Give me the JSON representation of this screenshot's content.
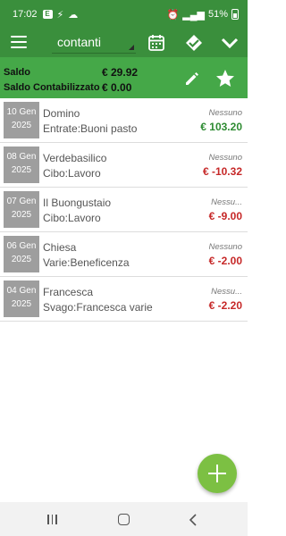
{
  "statusbar": {
    "time": "17:02",
    "battery": "51%"
  },
  "toolbar": {
    "account": "contanti"
  },
  "summary": {
    "saldo_label": "Saldo",
    "saldo_value": "€ 29.92",
    "contab_label": "Saldo Contabilizzato",
    "contab_value": "€ 0.00"
  },
  "transactions": [
    {
      "day": "10 Gen",
      "year": "2025",
      "description": "Domino",
      "category": "Entrate:Buoni pasto",
      "status": "Nessuno",
      "amount": "€ 103.20",
      "sign": "pos"
    },
    {
      "day": "08 Gen",
      "year": "2025",
      "description": "Verdebasilico",
      "category": "Cibo:Lavoro",
      "status": "Nessuno",
      "amount": "€ -10.32",
      "sign": "neg"
    },
    {
      "day": "07 Gen",
      "year": "2025",
      "description": "Il Buongustaio",
      "category": "Cibo:Lavoro",
      "status": "Nessu...",
      "amount": "€ -9.00",
      "sign": "neg"
    },
    {
      "day": "06 Gen",
      "year": "2025",
      "description": "Chiesa",
      "category": "Varie:Beneficenza",
      "status": "Nessuno",
      "amount": "€ -2.00",
      "sign": "neg"
    },
    {
      "day": "04 Gen",
      "year": "2025",
      "description": "Francesca",
      "category": "Svago:Francesca varie",
      "status": "Nessu...",
      "amount": "€ -2.20",
      "sign": "neg"
    }
  ],
  "colors": {
    "primary": "#3a8f3c",
    "header": "#45a848",
    "positive": "#2e8b32",
    "negative": "#c62828",
    "fab": "#7cc043"
  },
  "icons": [
    "menu-icon",
    "calendar-icon",
    "double-check-icon",
    "chevron-down-icon",
    "pencil-icon",
    "star-icon",
    "add-icon"
  ]
}
